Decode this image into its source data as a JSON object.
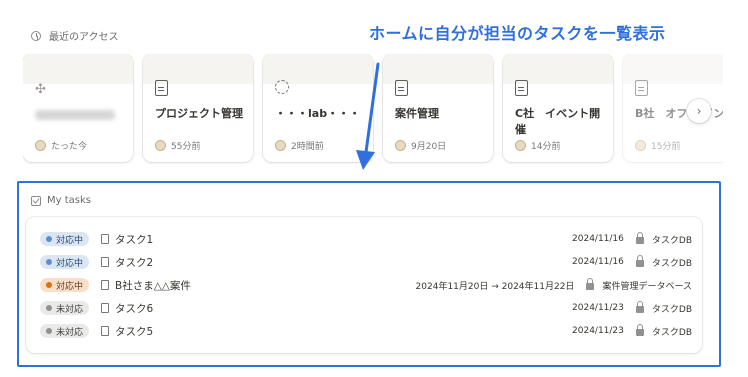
{
  "recent": {
    "heading": "最近のアクセス",
    "clock_icon": "clock-icon",
    "cards": [
      {
        "title": "",
        "icon": "plus-icon",
        "time": "たった今",
        "blurred": true
      },
      {
        "title": "プロジェクト管理",
        "icon": "page-icon",
        "time": "55分前"
      },
      {
        "title": "・・・lab・・・",
        "icon": "spiral-icon",
        "time": "2時間前"
      },
      {
        "title": "案件管理",
        "icon": "page-icon",
        "time": "9月20日"
      },
      {
        "title": "C社　イベント開催",
        "icon": "page-icon",
        "time": "14分前"
      },
      {
        "title": "B社　オフ ザイン",
        "icon": "page-icon",
        "time": "15分前"
      }
    ],
    "next_icon": "chevron-right-icon"
  },
  "callout": {
    "text": "ホームに自分が担当のタスクを一覧表示",
    "color": "#2f6fde"
  },
  "tasks": {
    "heading": "My tasks",
    "rows": [
      {
        "status": "対応中",
        "status_kind": "in-progress",
        "name": "タスク1",
        "date": "2024/11/16",
        "db": "タスクDB"
      },
      {
        "status": "対応中",
        "status_kind": "in-progress",
        "name": "タスク2",
        "date": "2024/11/16",
        "db": "タスクDB"
      },
      {
        "status": "対応中",
        "status_kind": "in-progress-orange",
        "name": "B社さま△△案件",
        "date": "2024年11月20日 → 2024年11月22日",
        "db": "案件管理データベース"
      },
      {
        "status": "未対応",
        "status_kind": "not-started",
        "name": "タスク6",
        "date": "2024/11/23",
        "db": "タスクDB"
      },
      {
        "status": "未対応",
        "status_kind": "not-started",
        "name": "タスク5",
        "date": "2024/11/23",
        "db": "タスクDB"
      }
    ]
  },
  "colors": {
    "accent_blue": "#2f6fde",
    "status_blue": "#5b8fd1",
    "status_orange": "#d9730d",
    "status_gray": "#91918e"
  }
}
